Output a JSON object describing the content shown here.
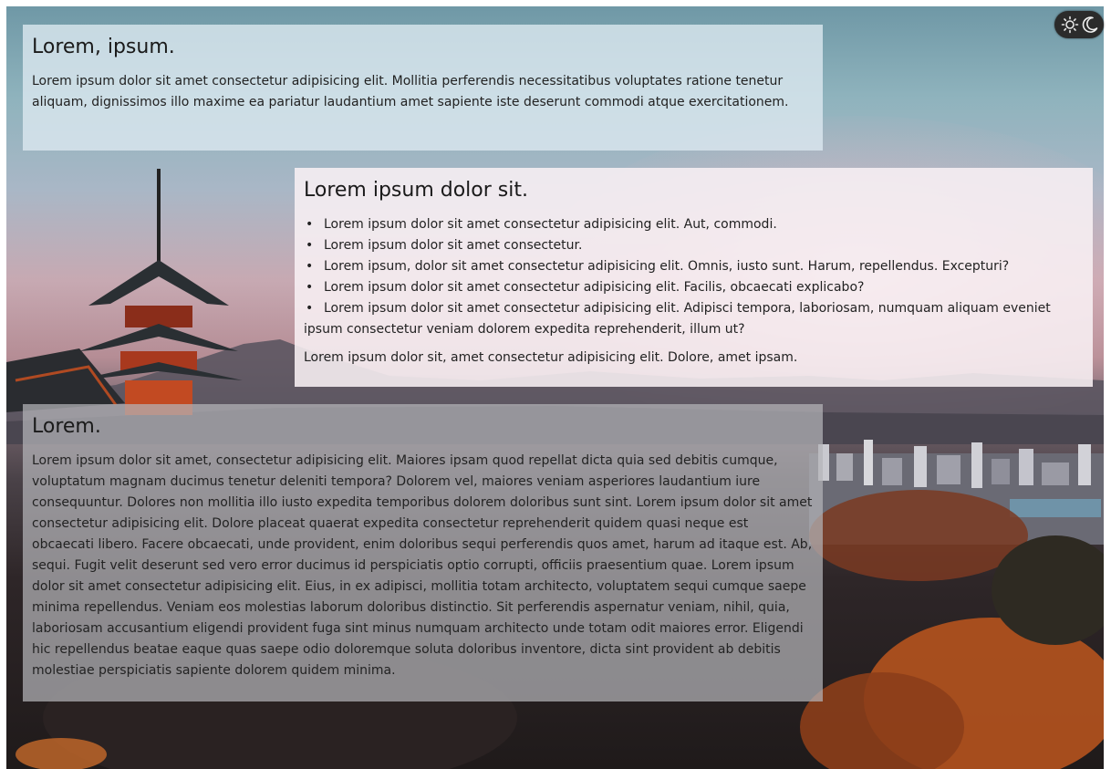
{
  "theme_toggle": {
    "icons": [
      "sun-icon",
      "moon-icon"
    ]
  },
  "sections": [
    {
      "title": "Lorem, ipsum.",
      "body": "Lorem ipsum dolor sit amet consectetur adipisicing elit. Mollitia perferendis necessitatibus voluptates ratione tenetur aliquam, dignissimos illo maxime ea pariatur laudantium amet sapiente iste deserunt commodi atque exercitationem."
    },
    {
      "title": "Lorem ipsum dolor sit.",
      "list": [
        "Lorem ipsum dolor sit amet consectetur adipisicing elit. Aut, commodi.",
        "Lorem ipsum dolor sit amet consectetur.",
        "Lorem ipsum, dolor sit amet consectetur adipisicing elit. Omnis, iusto sunt. Harum, repellendus. Excepturi?",
        "Lorem ipsum dolor sit amet consectetur adipisicing elit. Facilis, obcaecati explicabo?",
        "Lorem ipsum dolor sit amet consectetur adipisicing elit. Adipisci tempora, laboriosam, numquam aliquam eveniet ipsum consectetur veniam dolorem expedita reprehenderit, illum ut?"
      ],
      "body": "Lorem ipsum dolor sit, amet consectetur adipisicing elit. Dolore, amet ipsam."
    },
    {
      "title": "Lorem.",
      "body": "Lorem ipsum dolor sit amet, consectetur adipisicing elit. Maiores ipsam quod repellat dicta quia sed debitis cumque, voluptatum magnam ducimus tenetur deleniti tempora? Dolorem vel, maiores veniam asperiores laudantium iure consequuntur. Dolores non mollitia illo iusto expedita temporibus dolorem doloribus sunt sint. Lorem ipsum dolor sit amet consectetur adipisicing elit. Dolore placeat quaerat expedita consectetur reprehenderit quidem quasi neque est obcaecati libero. Facere obcaecati, unde provident, enim doloribus sequi perferendis quos amet, harum ad itaque est. Ab, sequi. Fugit velit deserunt sed vero error ducimus id perspiciatis optio corrupti, officiis praesentium quae. Lorem ipsum dolor sit amet consectetur adipisicing elit. Eius, in ex adipisci, mollitia totam architecto, voluptatem sequi cumque saepe minima repellendus. Veniam eos molestias laborum doloribus distinctio. Sit perferendis aspernatur veniam, nihil, quia, laboriosam accusantium eligendi provident fuga sint minus numquam architecto unde totam odit maiores error. Eligendi hic repellendus beatae eaque quas saepe odio doloremque soluta doloribus inventore, dicta sint provident ab debitis molestiae perspiciatis sapiente dolorem quidem minima."
    }
  ],
  "colors": {
    "toggle_bg": "#2b2b2b",
    "panel_text": "#222222"
  }
}
